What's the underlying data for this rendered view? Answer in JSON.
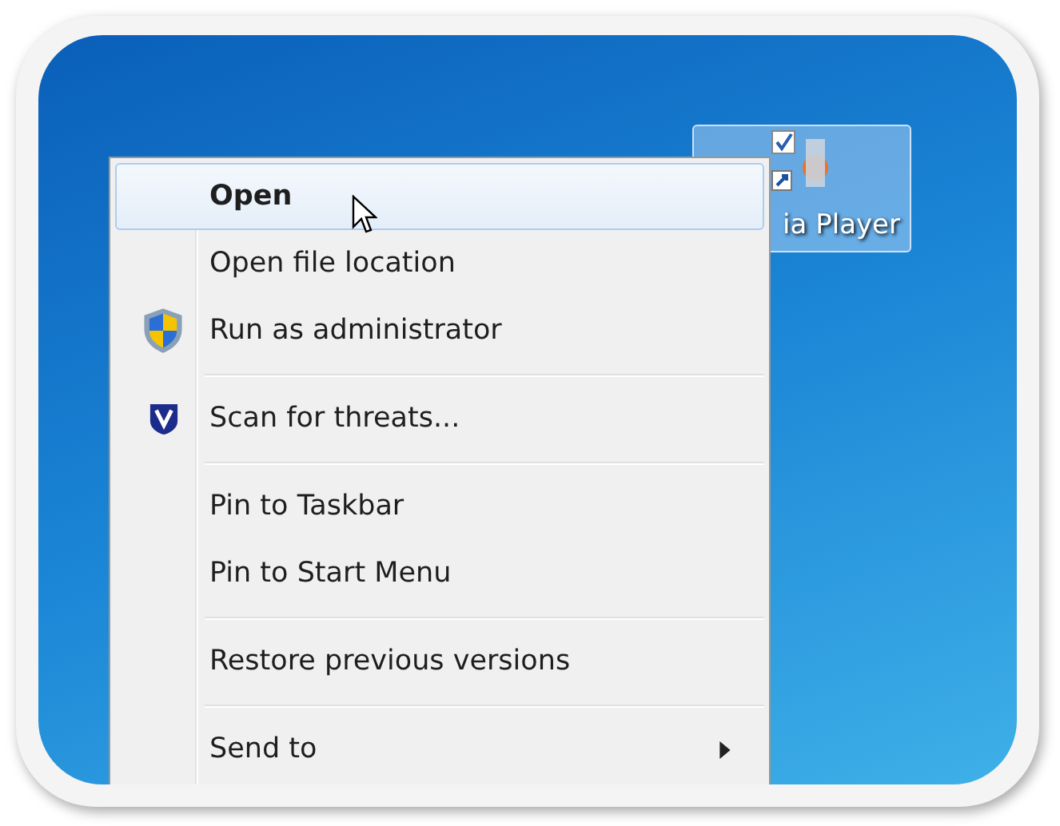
{
  "desktop_icon": {
    "label": "ia Player",
    "selected": true
  },
  "context_menu": {
    "items": [
      {
        "kind": "item",
        "label": "Open",
        "default": true,
        "selected": true
      },
      {
        "kind": "item",
        "label": "Open file location",
        "default": false,
        "selected": false
      },
      {
        "kind": "admin",
        "label": "Run as administrator",
        "default": false,
        "selected": false
      },
      {
        "kind": "separator"
      },
      {
        "kind": "scan",
        "label": "Scan for threats...",
        "default": false,
        "selected": false
      },
      {
        "kind": "separator"
      },
      {
        "kind": "item",
        "label": "Pin to Taskbar",
        "default": false,
        "selected": false
      },
      {
        "kind": "item",
        "label": "Pin to Start Menu",
        "default": false,
        "selected": false
      },
      {
        "kind": "separator"
      },
      {
        "kind": "item",
        "label": "Restore previous versions",
        "default": false,
        "selected": false
      },
      {
        "kind": "separator"
      },
      {
        "kind": "submenu",
        "label": "Send to",
        "default": false,
        "selected": false
      }
    ]
  }
}
